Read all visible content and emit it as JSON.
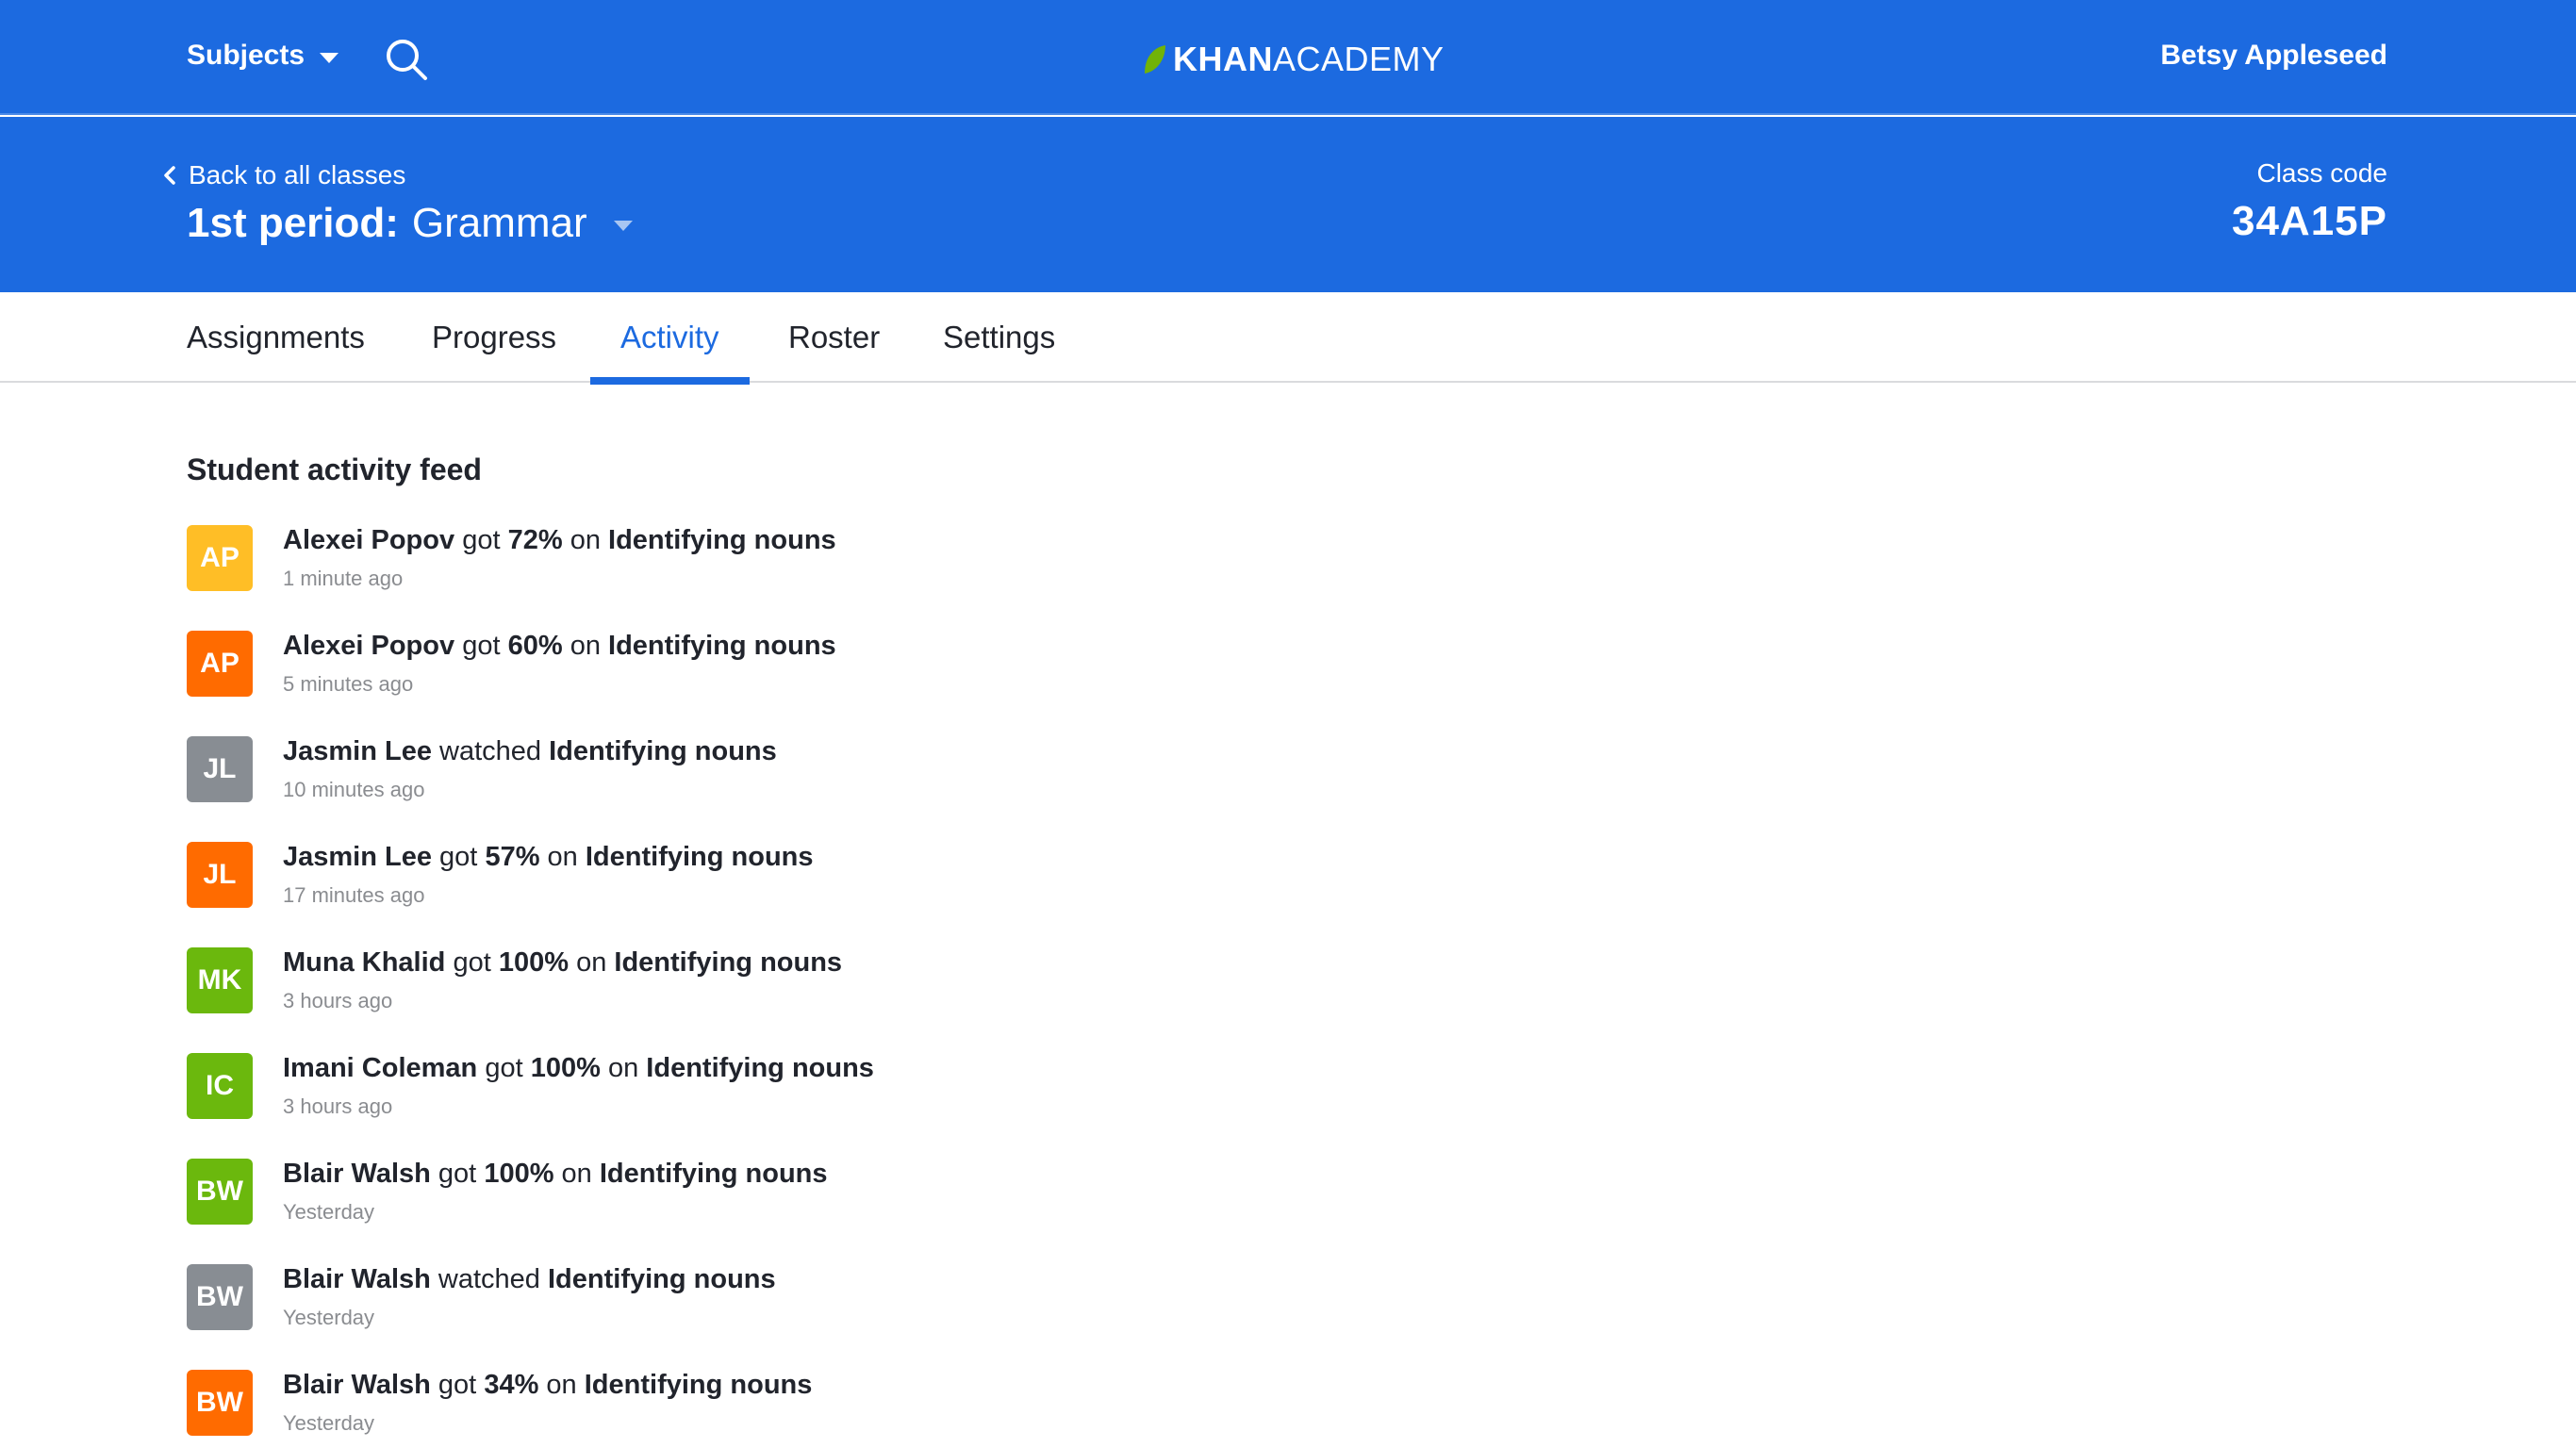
{
  "header": {
    "subjects_label": "Subjects",
    "logo_bold": "KHAN",
    "logo_light": "ACADEMY",
    "user_name": "Betsy Appleseed"
  },
  "classbar": {
    "back_label": "Back to all classes",
    "period": "1st period:",
    "subject": "Grammar",
    "code_label": "Class code",
    "code_value": "34A15P"
  },
  "tabs": [
    {
      "label": "Assignments",
      "active": false
    },
    {
      "label": "Progress",
      "active": false
    },
    {
      "label": "Activity",
      "active": true
    },
    {
      "label": "Roster",
      "active": false
    },
    {
      "label": "Settings",
      "active": false
    }
  ],
  "feed": {
    "title": "Student activity feed",
    "items": [
      {
        "initials": "AP",
        "color": "#ffbe26",
        "name": "Alexei Popov",
        "verb": "got",
        "score": "72%",
        "prep": "on",
        "target": "Identifying nouns",
        "time": "1 minute ago"
      },
      {
        "initials": "AP",
        "color": "#ff6b00",
        "name": "Alexei Popov",
        "verb": "got",
        "score": "60%",
        "prep": "on",
        "target": "Identifying nouns",
        "time": "5 minutes ago"
      },
      {
        "initials": "JL",
        "color": "#888d93",
        "name": "Jasmin Lee",
        "verb": "watched",
        "score": "",
        "prep": "",
        "target": "Identifying nouns",
        "time": "10 minutes ago"
      },
      {
        "initials": "JL",
        "color": "#ff6b00",
        "name": "Jasmin Lee",
        "verb": "got",
        "score": "57%",
        "prep": "on",
        "target": "Identifying nouns",
        "time": "17 minutes ago"
      },
      {
        "initials": "MK",
        "color": "#6bb80d",
        "name": "Muna Khalid",
        "verb": "got",
        "score": "100%",
        "prep": "on",
        "target": "Identifying nouns",
        "time": "3 hours ago"
      },
      {
        "initials": "IC",
        "color": "#6bb80d",
        "name": "Imani Coleman",
        "verb": "got",
        "score": "100%",
        "prep": "on",
        "target": "Identifying nouns",
        "time": "3 hours ago"
      },
      {
        "initials": "BW",
        "color": "#6bb80d",
        "name": "Blair Walsh",
        "verb": "got",
        "score": "100%",
        "prep": "on",
        "target": "Identifying nouns",
        "time": "Yesterday"
      },
      {
        "initials": "BW",
        "color": "#888d93",
        "name": "Blair Walsh",
        "verb": "watched",
        "score": "",
        "prep": "",
        "target": "Identifying nouns",
        "time": "Yesterday"
      },
      {
        "initials": "BW",
        "color": "#ff6b00",
        "name": "Blair Walsh",
        "verb": "got",
        "score": "34%",
        "prep": "on",
        "target": "Identifying nouns",
        "time": "Yesterday"
      }
    ]
  },
  "colors": {
    "brand_blue": "#1c6ae0",
    "leaf_green": "#71b307"
  }
}
